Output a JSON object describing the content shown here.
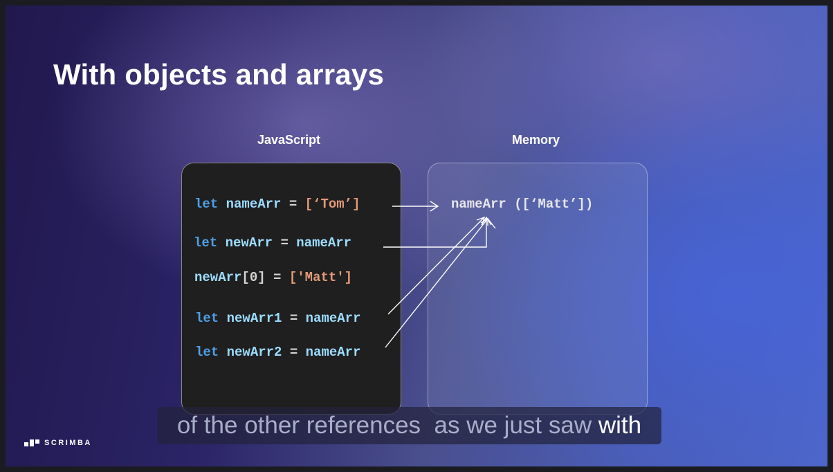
{
  "slide": {
    "title": "With objects and arrays",
    "columns": {
      "left": "JavaScript",
      "right": "Memory"
    }
  },
  "code_lines": [
    [
      {
        "t": "let",
        "c": "kw"
      },
      {
        "t": " nameArr",
        "c": "id"
      },
      {
        "t": " = ",
        "c": "op"
      },
      {
        "t": "[‘Tom’]",
        "c": "str"
      }
    ],
    [
      {
        "t": "let",
        "c": "kw"
      },
      {
        "t": " newArr",
        "c": "id"
      },
      {
        "t": " = ",
        "c": "op"
      },
      {
        "t": "nameArr",
        "c": "id"
      }
    ],
    [
      {
        "t": "newArr",
        "c": "id"
      },
      {
        "t": "[0]",
        "c": "op"
      },
      {
        "t": " = ",
        "c": "op"
      },
      {
        "t": "['Matt']",
        "c": "str"
      }
    ],
    [
      {
        "t": "let",
        "c": "kw"
      },
      {
        "t": " newArr1",
        "c": "id"
      },
      {
        "t": " = ",
        "c": "op"
      },
      {
        "t": "nameArr",
        "c": "id"
      }
    ],
    [
      {
        "t": "let",
        "c": "kw"
      },
      {
        "t": " newArr2",
        "c": "id"
      },
      {
        "t": " = ",
        "c": "op"
      },
      {
        "t": "nameArr",
        "c": "id"
      }
    ]
  ],
  "memory": {
    "value": "nameArr ([‘Matt’])"
  },
  "caption": {
    "dim": "of the other references  as we just saw ",
    "highlight": "with"
  },
  "brand": {
    "name": "SCRIMBA"
  }
}
